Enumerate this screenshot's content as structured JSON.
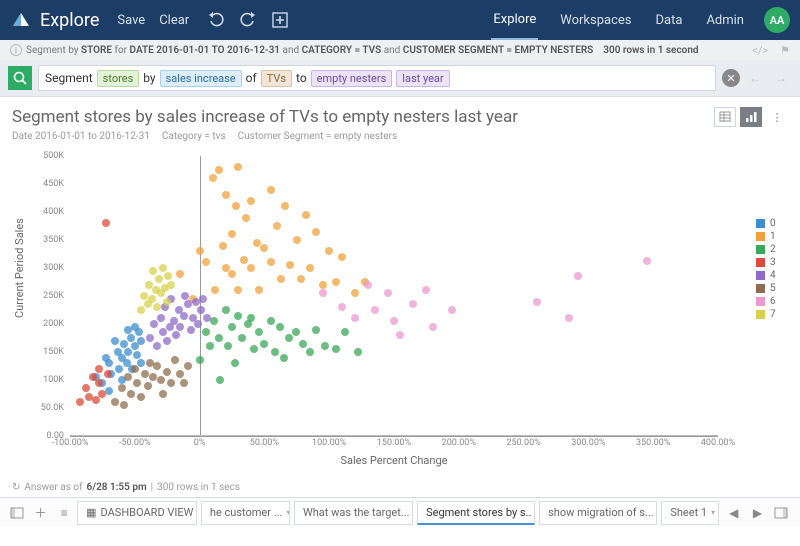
{
  "topbar": {
    "brand": "Explore",
    "save": "Save",
    "clear": "Clear",
    "nav": [
      "Explore",
      "Workspaces",
      "Data",
      "Admin"
    ],
    "activeNav": 0,
    "avatar": "AA"
  },
  "crumb": {
    "prefix": "Segment by",
    "strong1": "STORE",
    "for": "for",
    "strong2": "DATE 2016-01-01 TO 2016-12-31",
    "and1": "and",
    "strong3": "CATEGORY = TVS",
    "and2": "and",
    "strong4": "CUSTOMER SEGMENT = EMPTY NESTERS",
    "result": "300 rows in 1 second"
  },
  "query": {
    "t1": "Segment",
    "tok1": "stores",
    "t2": "by",
    "tok2": "sales increase",
    "t3": "of",
    "tok3": "TVs",
    "t4": "to",
    "tok4": "empty nesters",
    "tok5": "last year"
  },
  "title": "Segment stores by sales increase of TVs to empty nesters last year",
  "filters": [
    "Date 2016-01-01 to 2016-12-31",
    "Category = tvs",
    "Customer Segment = empty nesters"
  ],
  "answer": {
    "prefix": "Answer as of",
    "time": "6/28 1:55 pm",
    "rows": "300 rows in 1 secs"
  },
  "bottomTabs": [
    {
      "label": "DASHBOARD VIEW",
      "icon": true
    },
    {
      "label": "he customer ..."
    },
    {
      "label": "What was the target..."
    },
    {
      "label": "Segment stores by s..",
      "active": true
    },
    {
      "label": "show migration of s..."
    },
    {
      "label": "Sheet 1"
    }
  ],
  "chart_data": {
    "type": "scatter",
    "xlabel": "Sales Percent Change",
    "ylabel": "Current Period Sales",
    "xlim": [
      -100,
      400
    ],
    "ylim": [
      0,
      500000
    ],
    "xticks": [
      -100,
      -50,
      0,
      50,
      100,
      150,
      200,
      250,
      300,
      350,
      400
    ],
    "yticks": [
      0,
      50000,
      100000,
      150000,
      200000,
      250000,
      300000,
      350000,
      400000,
      450000,
      500000
    ],
    "ytickLabels": [
      "0.00",
      "50.0K",
      "100K",
      "150K",
      "200K",
      "250K",
      "300K",
      "350K",
      "400K",
      "450K",
      "500K"
    ],
    "xtickLabels": [
      "-100.00%",
      "-50.00%",
      "0%",
      "50.00%",
      "100.00%",
      "150.00%",
      "200.00%",
      "250.00%",
      "300.00%",
      "350.00%",
      "400.00%"
    ],
    "zeroX": 0,
    "zeroY": 0,
    "series": [
      {
        "name": "0",
        "color": "#3b8ed0",
        "points": [
          [
            -80,
            105
          ],
          [
            -75,
            95
          ],
          [
            -72,
            140
          ],
          [
            -70,
            80
          ],
          [
            -70,
            130
          ],
          [
            -68,
            110
          ],
          [
            -65,
            170
          ],
          [
            -63,
            150
          ],
          [
            -62,
            120
          ],
          [
            -60,
            140
          ],
          [
            -60,
            100
          ],
          [
            -58,
            165
          ],
          [
            -56,
            130
          ],
          [
            -55,
            190
          ],
          [
            -55,
            150
          ],
          [
            -53,
            175
          ],
          [
            -52,
            120
          ],
          [
            -50,
            195
          ],
          [
            -50,
            160
          ],
          [
            -48,
            145
          ],
          [
            -47,
            185
          ],
          [
            -45,
            170
          ],
          [
            -45,
            130
          ]
        ]
      },
      {
        "name": "1",
        "color": "#f0a13c",
        "points": [
          [
            -15,
            290
          ],
          [
            -5,
            245
          ],
          [
            0,
            330
          ],
          [
            5,
            310
          ],
          [
            10,
            460
          ],
          [
            12,
            260
          ],
          [
            15,
            475
          ],
          [
            18,
            340
          ],
          [
            20,
            300
          ],
          [
            20,
            430
          ],
          [
            25,
            360
          ],
          [
            25,
            290
          ],
          [
            28,
            410
          ],
          [
            30,
            260
          ],
          [
            30,
            480
          ],
          [
            34,
            315
          ],
          [
            36,
            390
          ],
          [
            40,
            420
          ],
          [
            40,
            300
          ],
          [
            44,
            345
          ],
          [
            46,
            260
          ],
          [
            50,
            335
          ],
          [
            55,
            440
          ],
          [
            55,
            310
          ],
          [
            60,
            375
          ],
          [
            63,
            280
          ],
          [
            66,
            410
          ],
          [
            70,
            305
          ],
          [
            75,
            350
          ],
          [
            78,
            280
          ],
          [
            82,
            395
          ],
          [
            85,
            300
          ],
          [
            90,
            365
          ],
          [
            95,
            270
          ],
          [
            100,
            330
          ],
          [
            105,
            275
          ],
          [
            110,
            320
          ],
          [
            120,
            255
          ],
          [
            128,
            275
          ]
        ]
      },
      {
        "name": "2",
        "color": "#3aa757",
        "points": [
          [
            0,
            135
          ],
          [
            5,
            185
          ],
          [
            8,
            160
          ],
          [
            11,
            205
          ],
          [
            15,
            175
          ],
          [
            16,
            100
          ],
          [
            20,
            225
          ],
          [
            22,
            160
          ],
          [
            25,
            195
          ],
          [
            27,
            130
          ],
          [
            30,
            215
          ],
          [
            33,
            175
          ],
          [
            37,
            200
          ],
          [
            40,
            210
          ],
          [
            42,
            155
          ],
          [
            46,
            185
          ],
          [
            50,
            165
          ],
          [
            55,
            205
          ],
          [
            58,
            150
          ],
          [
            62,
            195
          ],
          [
            65,
            140
          ],
          [
            69,
            175
          ],
          [
            74,
            185
          ],
          [
            80,
            165
          ],
          [
            85,
            150
          ],
          [
            90,
            190
          ],
          [
            97,
            160
          ],
          [
            105,
            155
          ],
          [
            112,
            185
          ],
          [
            122,
            150
          ]
        ]
      },
      {
        "name": "3",
        "color": "#d94b3a",
        "points": [
          [
            -92,
            60
          ],
          [
            -88,
            85
          ],
          [
            -85,
            70
          ],
          [
            -82,
            105
          ],
          [
            -80,
            65
          ],
          [
            -78,
            120
          ],
          [
            -78,
            95
          ],
          [
            -75,
            75
          ],
          [
            -72,
            380
          ],
          [
            -71,
            110
          ]
        ]
      },
      {
        "name": "4",
        "color": "#8f6bc8",
        "points": [
          [
            -38,
            175
          ],
          [
            -35,
            200
          ],
          [
            -33,
            160
          ],
          [
            -30,
            210
          ],
          [
            -28,
            185
          ],
          [
            -27,
            230
          ],
          [
            -25,
            170
          ],
          [
            -23,
            195
          ],
          [
            -22,
            245
          ],
          [
            -20,
            205
          ],
          [
            -18,
            180
          ],
          [
            -16,
            225
          ],
          [
            -15,
            195
          ],
          [
            -12,
            215
          ],
          [
            -11,
            250
          ],
          [
            -9,
            235
          ],
          [
            -7,
            190
          ],
          [
            -5,
            210
          ],
          [
            -3,
            240
          ],
          [
            -1,
            200
          ],
          [
            1,
            225
          ],
          [
            3,
            245
          ],
          [
            6,
            210
          ]
        ]
      },
      {
        "name": "5",
        "color": "#8f6d4e",
        "points": [
          [
            -65,
            60
          ],
          [
            -60,
            85
          ],
          [
            -58,
            55
          ],
          [
            -55,
            105
          ],
          [
            -53,
            75
          ],
          [
            -50,
            120
          ],
          [
            -48,
            95
          ],
          [
            -45,
            70
          ],
          [
            -42,
            110
          ],
          [
            -40,
            90
          ],
          [
            -38,
            130
          ],
          [
            -36,
            105
          ],
          [
            -33,
            125
          ],
          [
            -30,
            100
          ],
          [
            -28,
            75
          ],
          [
            -25,
            115
          ],
          [
            -22,
            95
          ],
          [
            -19,
            135
          ],
          [
            -15,
            110
          ],
          [
            -12,
            95
          ],
          [
            -9,
            125
          ]
        ]
      },
      {
        "name": "6",
        "color": "#e99ad0",
        "points": [
          [
            95,
            255
          ],
          [
            110,
            230
          ],
          [
            120,
            210
          ],
          [
            130,
            270
          ],
          [
            135,
            225
          ],
          [
            145,
            255
          ],
          [
            150,
            205
          ],
          [
            155,
            180
          ],
          [
            165,
            235
          ],
          [
            175,
            260
          ],
          [
            180,
            195
          ],
          [
            195,
            225
          ],
          [
            260,
            240
          ],
          [
            285,
            210
          ],
          [
            292,
            285
          ],
          [
            345,
            312
          ]
        ]
      },
      {
        "name": "7",
        "color": "#d7d14c",
        "points": [
          [
            -45,
            225
          ],
          [
            -43,
            250
          ],
          [
            -40,
            235
          ],
          [
            -39,
            270
          ],
          [
            -37,
            245
          ],
          [
            -36,
            295
          ],
          [
            -34,
            260
          ],
          [
            -33,
            230
          ],
          [
            -31,
            280
          ],
          [
            -30,
            255
          ],
          [
            -28,
            300
          ],
          [
            -27,
            265
          ],
          [
            -25,
            240
          ],
          [
            -24,
            285
          ],
          [
            -22,
            270
          ]
        ]
      }
    ]
  }
}
